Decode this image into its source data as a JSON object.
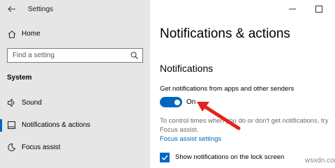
{
  "window": {
    "title": "Settings"
  },
  "sidebar": {
    "home_label": "Home",
    "search_placeholder": "Find a setting",
    "section_header": "System",
    "items": [
      {
        "label": "Sound",
        "icon": "speaker-icon"
      },
      {
        "label": "Notifications & actions",
        "icon": "notification-icon",
        "active": true
      },
      {
        "label": "Focus assist",
        "icon": "moon-icon"
      }
    ]
  },
  "main": {
    "page_title": "Notifications & actions",
    "notifications_heading": "Notifications",
    "toggle_description": "Get notifications from apps and other senders",
    "toggle_state": "On",
    "help_line1": "To control times when you do or don't get notifications, try",
    "help_line2": "Focus assist.",
    "help_link": "Focus assist settings",
    "lock_screen_checkbox_label": "Show notifications on the lock screen"
  },
  "watermark": "wsxdn.com",
  "colors": {
    "accent": "#0067c0",
    "link": "#0066b4",
    "sidebar_bg": "#e6e6e6",
    "annotation": "#e3231c"
  }
}
